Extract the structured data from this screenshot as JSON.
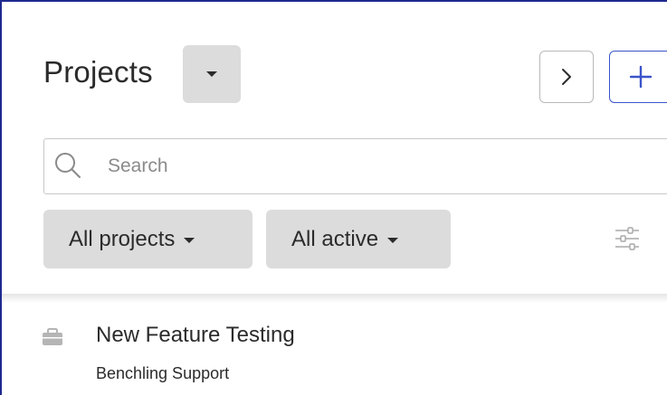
{
  "header": {
    "title": "Projects",
    "collapse_label": ">",
    "add_label": "+"
  },
  "search": {
    "placeholder": "Search",
    "value": ""
  },
  "filters": {
    "projects_label": "All projects",
    "status_label": "All active"
  },
  "projects": [
    {
      "name": "New Feature Testing",
      "organization": "Benchling Support"
    }
  ],
  "colors": {
    "accent": "#3a55c9",
    "frame": "#1f2a8f",
    "chip_bg": "#dcdcdc",
    "text": "#2b2b2b",
    "placeholder": "#8a8a8a"
  },
  "icons": {
    "title_dropdown": "caret-down-icon",
    "collapse": "chevron-right-icon",
    "add": "plus-icon",
    "search": "search-icon",
    "filter_settings": "sliders-icon",
    "project": "briefcase-icon"
  }
}
